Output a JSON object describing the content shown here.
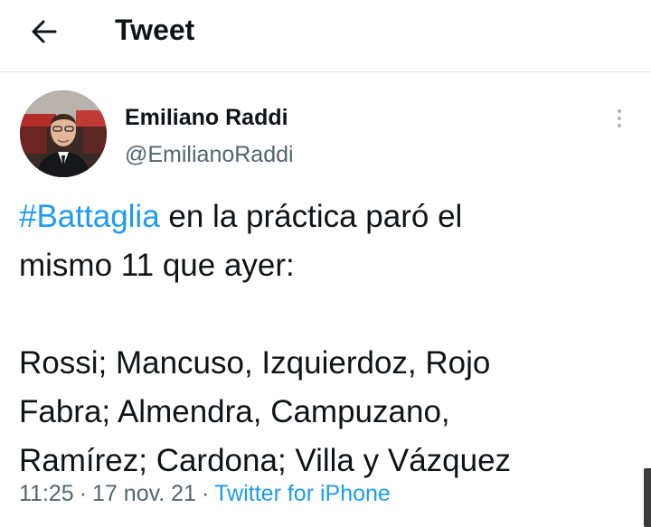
{
  "header": {
    "back_icon": "arrow-left-icon",
    "title": "Tweet"
  },
  "author": {
    "display_name": "Emiliano Raddi",
    "handle": "@EmilianoRaddi"
  },
  "more_icon": "more-vertical-icon",
  "tweet": {
    "line1_hashtag": "#Battaglia",
    "line1_rest": " en la práctica paró el",
    "line2": "mismo 11 que ayer:",
    "line3": "",
    "line4": "Rossi; Mancuso, Izquierdoz, Rojo",
    "line5": "Fabra; Almendra, Campuzano,",
    "line6": "Ramírez; Cardona; Villa y Vázquez"
  },
  "meta": {
    "time": "11:25",
    "separator": "·",
    "date": "17 nov. 21",
    "source": "Twitter for iPhone"
  },
  "colors": {
    "link": "#1d9bf0",
    "text": "#0f1419",
    "secondary": "#536471"
  }
}
